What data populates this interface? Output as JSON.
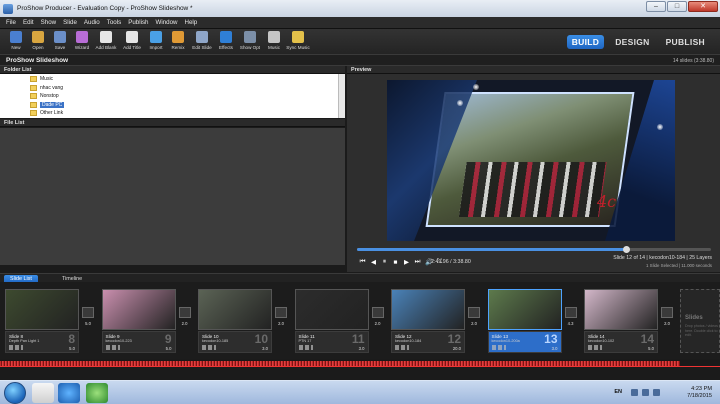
{
  "window": {
    "title": "ProShow Producer - Evaluation Copy - ProShow Slideshow *"
  },
  "menu": [
    "File",
    "Edit",
    "Show",
    "Slide",
    "Audio",
    "Tools",
    "Publish",
    "Window",
    "Help"
  ],
  "toolbar": {
    "tools": [
      {
        "label": "New",
        "icon": "new-show-icon",
        "color": "#4a7fd0"
      },
      {
        "label": "Open",
        "icon": "open-folder-icon",
        "color": "#d9a640"
      },
      {
        "label": "Save",
        "icon": "save-disk-icon",
        "color": "#6b8fc9"
      },
      {
        "label": "Wizard",
        "icon": "wizard-icon",
        "color": "#b86dd6"
      },
      {
        "label": "Add Blank",
        "icon": "add-blank-icon",
        "color": "#e6e6e6"
      },
      {
        "label": "Add Title",
        "icon": "add-title-icon",
        "color": "#e6e6e6"
      },
      {
        "label": "Import",
        "icon": "import-icon",
        "color": "#4aa0e6"
      },
      {
        "label": "Remix",
        "icon": "remix-icon",
        "color": "#e09a35"
      },
      {
        "label": "Edit Slide",
        "icon": "edit-slide-icon",
        "color": "#8fa6c8"
      },
      {
        "label": "Effects",
        "icon": "effects-fx-icon",
        "color": "#2f7fd6"
      },
      {
        "label": "Show Opt",
        "icon": "show-options-icon",
        "color": "#7c8fa8"
      },
      {
        "label": "Music",
        "icon": "music-speaker-icon",
        "color": "#c5c5c5"
      },
      {
        "label": "Sync Music",
        "icon": "sync-music-icon",
        "color": "#e3c04a"
      }
    ],
    "modes": [
      {
        "label": "BUILD",
        "active": true
      },
      {
        "label": "DESIGN",
        "active": false
      },
      {
        "label": "PUBLISH",
        "active": false
      }
    ]
  },
  "show": {
    "title": "ProShow Slideshow",
    "info": "14 slides (3:38.80)"
  },
  "folder_list": {
    "header": "Folder List",
    "folders": [
      {
        "name": "Music",
        "selected": false
      },
      {
        "name": "nhac vang",
        "selected": false
      },
      {
        "name": "Nonstop",
        "selected": false
      },
      {
        "name": "Dade PC",
        "selected": true
      },
      {
        "name": "Other Link",
        "selected": false
      }
    ]
  },
  "file_list": {
    "header": "File List"
  },
  "preview": {
    "header": "Preview",
    "progress": 0.76,
    "time": "2:49.96 / 3:38.80",
    "slide_info": "Slide 12 of 14  |  kecodon10-184  |  25 Layers",
    "slide_sub": "1 Slide Selected  |  11.000 seconds",
    "controls": [
      "⏮",
      "◀",
      "⏸",
      "■",
      "▶",
      "⏭",
      "🔊",
      "⛶"
    ]
  },
  "tabs": [
    "Slide List",
    "Timeline"
  ],
  "slides": [
    {
      "name": "Slide 8",
      "sub": "Depth Pan Light 1",
      "num": "8",
      "dur": "5.0",
      "trans_dur": "5.0",
      "selected": false,
      "thumb": "#3d4a2f"
    },
    {
      "name": "Slide 9",
      "sub": "kecodon10-223",
      "num": "9",
      "dur": "5.0",
      "trans_dur": "2.0",
      "selected": false,
      "thumb": "#c98fae"
    },
    {
      "name": "Slide 10",
      "sub": "kecodon10-185",
      "num": "10",
      "dur": "3.0",
      "trans_dur": "2.0",
      "selected": false,
      "thumb": "#5b6355"
    },
    {
      "name": "Slide 11",
      "sub": "PTN 17",
      "num": "11",
      "dur": "3.0",
      "trans_dur": "2.0",
      "selected": false,
      "thumb": "#2c2c2c"
    },
    {
      "name": "Slide 12",
      "sub": "kecodon10-184",
      "num": "12",
      "dur": "20.0",
      "trans_dur": "2.0",
      "selected": false,
      "thumb": "#4a82b8"
    },
    {
      "name": "Slide 13",
      "sub": "kecodon10-200a",
      "num": "13",
      "dur": "3.0",
      "trans_dur": "4.3",
      "selected": true,
      "thumb": "#5d7a4c"
    },
    {
      "name": "Slide 14",
      "sub": "kecodon10-102",
      "num": "14",
      "dur": "5.0",
      "trans_dur": "2.0",
      "selected": false,
      "thumb": "#d3b7c9"
    }
  ],
  "placeholder": {
    "title": "Slides",
    "text": "Drop photos / videos here. Double click to edit."
  },
  "taskbar": {
    "lang": "EN",
    "time": "4:23 PM",
    "date": "7/18/2015"
  }
}
